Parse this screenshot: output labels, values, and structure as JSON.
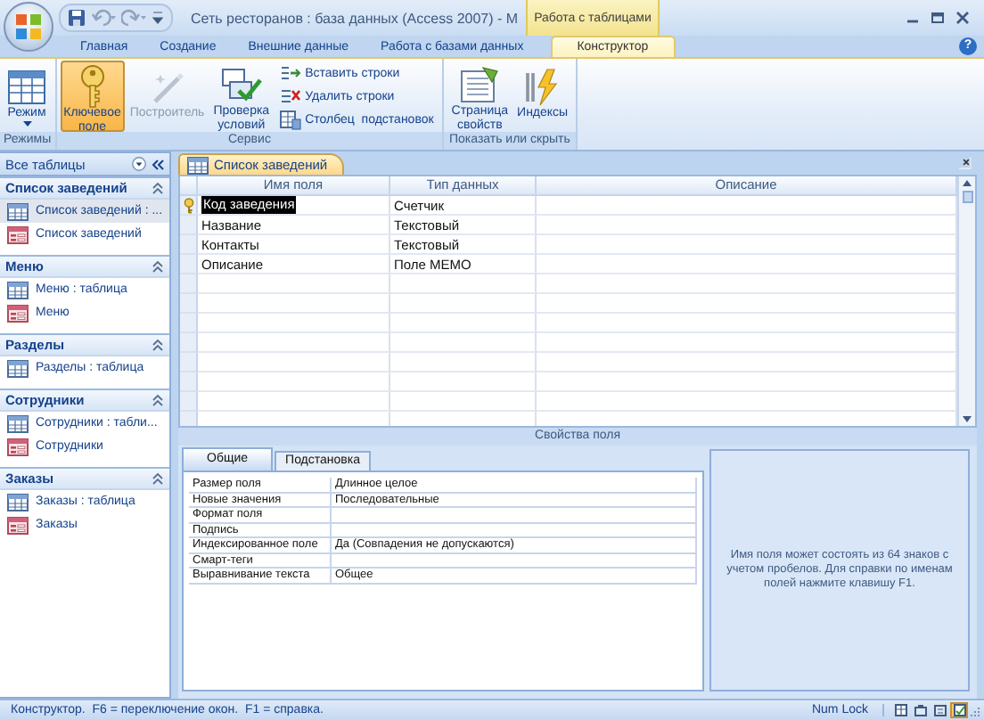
{
  "window": {
    "title": "Сеть ресторанов : база данных (Access 2007) - M",
    "context_tab": "Работа с таблицами"
  },
  "ribbon": {
    "tabs": [
      {
        "label": "Главная",
        "selected": false
      },
      {
        "label": "Создание",
        "selected": false
      },
      {
        "label": "Внешние данные",
        "selected": false
      },
      {
        "label": "Работа с базами данных",
        "selected": false
      },
      {
        "label": "Конструктор",
        "selected": true
      }
    ],
    "help_button": "?",
    "groups": [
      {
        "label": "Режимы",
        "buttons": [
          {
            "label": "Режим",
            "kind": "large",
            "on": false,
            "disabled": false
          }
        ]
      },
      {
        "label": "Сервис",
        "buttons": [
          {
            "label": "Ключевое поле",
            "kind": "large",
            "on": true,
            "disabled": false
          },
          {
            "label": "Построитель",
            "kind": "large",
            "on": false,
            "disabled": true
          },
          {
            "label": "Проверка условий",
            "kind": "large",
            "on": false,
            "disabled": false
          },
          {
            "label": "Вставить строки",
            "kind": "small",
            "on": false,
            "disabled": false
          },
          {
            "label": "Удалить строки",
            "kind": "small",
            "on": false,
            "disabled": false
          },
          {
            "label": "Столбец  подстановок",
            "kind": "small",
            "on": false,
            "disabled": false
          }
        ]
      },
      {
        "label": "Показать или скрыть",
        "buttons": [
          {
            "label": "Страница свойств",
            "kind": "large",
            "on": false,
            "disabled": false
          },
          {
            "label": "Индексы",
            "kind": "large",
            "on": false,
            "disabled": false
          }
        ]
      }
    ]
  },
  "navigation": {
    "title": "Все таблицы",
    "groups": [
      {
        "title": "Список заведений",
        "items": [
          {
            "label": "Список заведений : ...",
            "kind": "table",
            "selected": true
          },
          {
            "label": "Список заведений",
            "kind": "form",
            "selected": false
          }
        ]
      },
      {
        "title": "Меню",
        "items": [
          {
            "label": "Меню : таблица",
            "kind": "table",
            "selected": false
          },
          {
            "label": "Меню",
            "kind": "form",
            "selected": false
          }
        ]
      },
      {
        "title": "Разделы",
        "items": [
          {
            "label": "Разделы : таблица",
            "kind": "table",
            "selected": false
          }
        ]
      },
      {
        "title": "Сотрудники",
        "items": [
          {
            "label": "Сотрудники : табли...",
            "kind": "table",
            "selected": false
          },
          {
            "label": "Сотрудники",
            "kind": "form",
            "selected": false
          }
        ]
      },
      {
        "title": "Заказы",
        "items": [
          {
            "label": "Заказы : таблица",
            "kind": "table",
            "selected": false
          },
          {
            "label": "Заказы",
            "kind": "form",
            "selected": false
          }
        ]
      }
    ]
  },
  "document": {
    "tab": "Список заведений",
    "columns": [
      "Имя поля",
      "Тип данных",
      "Описание"
    ],
    "rows": [
      {
        "name": "Код заведения",
        "type": "Счетчик",
        "primary_key": true,
        "selected": true
      },
      {
        "name": "Название",
        "type": "Текстовый",
        "primary_key": false,
        "selected": false
      },
      {
        "name": "Контакты",
        "type": "Текстовый",
        "primary_key": false,
        "selected": false
      },
      {
        "name": "Описание",
        "type": "Поле MEMO",
        "primary_key": false,
        "selected": false
      }
    ]
  },
  "field_properties": {
    "title": "Свойства поля",
    "tabs": [
      {
        "label": "Общие",
        "selected": true
      },
      {
        "label": "Подстановка",
        "selected": false
      }
    ],
    "rows": [
      {
        "label": "Размер поля",
        "value": "Длинное целое"
      },
      {
        "label": "Новые значения",
        "value": "Последовательные"
      },
      {
        "label": "Формат поля"
      },
      {
        "label": "Подпись"
      },
      {
        "label": "Индексированное поле",
        "value": "Да (Совпадения не допускаются)"
      },
      {
        "label": "Смарт-теги"
      },
      {
        "label": "Выравнивание текста",
        "value": "Общее"
      }
    ],
    "help": "Имя поля может состоять из 64 знаков с учетом пробелов.  Для справки по именам полей нажмите клавишу F1."
  },
  "status_bar": {
    "text": "Конструктор.  F6 = переключение окон.  F1 = справка.",
    "num_lock": "Num Lock",
    "views": [
      {
        "selected": false
      },
      {
        "selected": false
      },
      {
        "selected": false
      },
      {
        "selected": true
      }
    ]
  }
}
